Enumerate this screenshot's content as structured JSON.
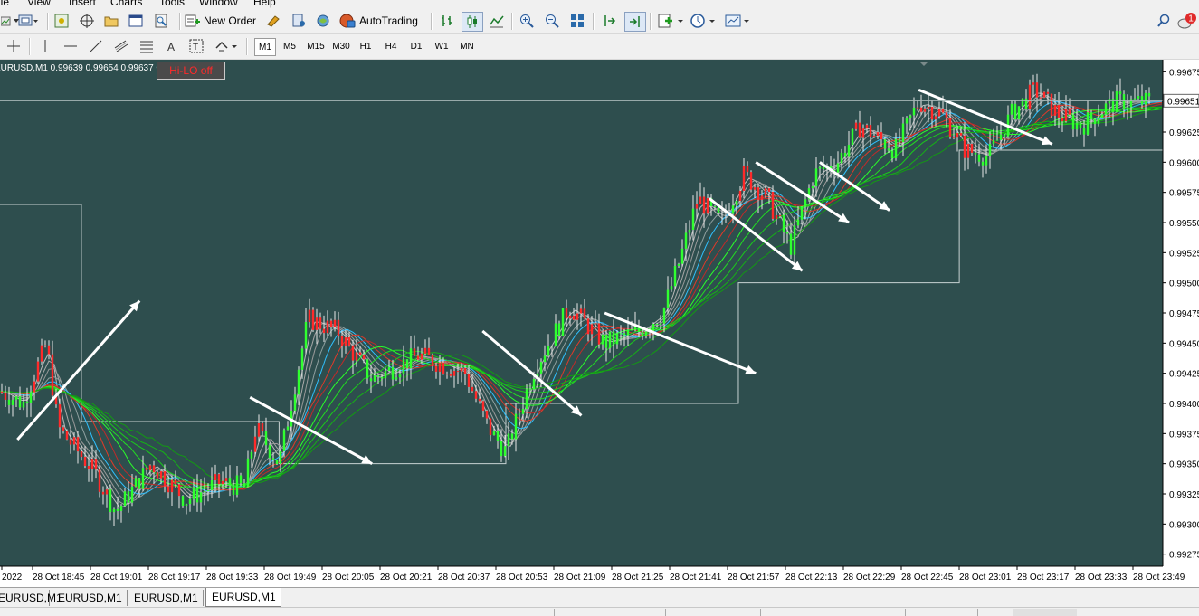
{
  "menu": [
    {
      "label": "ile"
    },
    {
      "label": "View"
    },
    {
      "label": "Insert"
    },
    {
      "label": "Charts"
    },
    {
      "label": "Tools"
    },
    {
      "label": "Window"
    },
    {
      "label": "Help"
    }
  ],
  "toolbar": {
    "new_order": "New Order",
    "auto_trading": "AutoTrading",
    "notification_count": "1"
  },
  "timeframes": [
    "M1",
    "M5",
    "M15",
    "M30",
    "H1",
    "H4",
    "D1",
    "W1",
    "MN"
  ],
  "active_timeframe": "M1",
  "chart_info": {
    "symbol_text": "EURUSD,M1  0.99639 0.99654 0.99637 0.99",
    "indicator_button": "Hi-LO off",
    "indicator_color": "#ff2a2a",
    "background_color": "#2e4e4e",
    "current_price": "0.99651"
  },
  "chart_data": {
    "type": "candlestick",
    "symbol": "EURUSD",
    "timeframe": "M1",
    "price_axis": [
      "0.99675",
      "0.99650",
      "0.99625",
      "0.99600",
      "0.99575",
      "0.99550",
      "0.99525",
      "0.99500",
      "0.99475",
      "0.99450",
      "0.99425",
      "0.99400",
      "0.99375",
      "0.99350",
      "0.99325",
      "0.99300",
      "0.99275"
    ],
    "time_axis": [
      "2022",
      "28 Oct 18:45",
      "28 Oct 19:01",
      "28 Oct 19:17",
      "28 Oct 19:33",
      "28 Oct 19:49",
      "28 Oct 20:05",
      "28 Oct 20:21",
      "28 Oct 20:37",
      "28 Oct 20:53",
      "28 Oct 21:09",
      "28 Oct 21:25",
      "28 Oct 21:41",
      "28 Oct 21:57",
      "28 Oct 22:13",
      "28 Oct 22:29",
      "28 Oct 22:45",
      "28 Oct 23:01",
      "28 Oct 23:17",
      "28 Oct 23:33",
      "28 Oct 23:49"
    ],
    "ylim": [
      0.99265,
      0.99685
    ],
    "current_price": 0.99651,
    "price_path": [
      [
        0,
        0.9941
      ],
      [
        0.02,
        0.994
      ],
      [
        0.04,
        0.9945
      ],
      [
        0.05,
        0.9938
      ],
      [
        0.08,
        0.99345
      ],
      [
        0.1,
        0.9931
      ],
      [
        0.13,
        0.9935
      ],
      [
        0.16,
        0.9932
      ],
      [
        0.19,
        0.99335
      ],
      [
        0.21,
        0.9933
      ],
      [
        0.22,
        0.9938
      ],
      [
        0.24,
        0.9935
      ],
      [
        0.265,
        0.9947
      ],
      [
        0.29,
        0.9946
      ],
      [
        0.32,
        0.9942
      ],
      [
        0.36,
        0.9944
      ],
      [
        0.4,
        0.99425
      ],
      [
        0.42,
        0.9938
      ],
      [
        0.435,
        0.9936
      ],
      [
        0.46,
        0.9943
      ],
      [
        0.49,
        0.9948
      ],
      [
        0.52,
        0.9945
      ],
      [
        0.55,
        0.9946
      ],
      [
        0.57,
        0.99475
      ],
      [
        0.585,
        0.9952
      ],
      [
        0.6,
        0.9957
      ],
      [
        0.62,
        0.9955
      ],
      [
        0.64,
        0.9959
      ],
      [
        0.66,
        0.9957
      ],
      [
        0.68,
        0.9953
      ],
      [
        0.7,
        0.9959
      ],
      [
        0.72,
        0.996
      ],
      [
        0.74,
        0.9963
      ],
      [
        0.77,
        0.9961
      ],
      [
        0.79,
        0.9965
      ],
      [
        0.81,
        0.9964
      ],
      [
        0.83,
        0.9961
      ],
      [
        0.85,
        0.99605
      ],
      [
        0.87,
        0.9964
      ],
      [
        0.89,
        0.9966
      ],
      [
        0.91,
        0.9964
      ],
      [
        0.93,
        0.9963
      ],
      [
        0.95,
        0.99645
      ],
      [
        0.96,
        0.9965
      ]
    ],
    "hilo_steps": [
      [
        0,
        0.99565
      ],
      [
        0.07,
        0.99565
      ],
      [
        0.07,
        0.99385
      ],
      [
        0.24,
        0.99385
      ],
      [
        0.24,
        0.9935
      ],
      [
        0.435,
        0.9935
      ],
      [
        0.435,
        0.994
      ],
      [
        0.635,
        0.994
      ],
      [
        0.635,
        0.995
      ],
      [
        0.825,
        0.995
      ],
      [
        0.825,
        0.9961
      ],
      [
        1.0,
        0.9961
      ]
    ],
    "arrows": [
      [
        [
          0.015,
          0.9937
        ],
        [
          0.12,
          0.99485
        ]
      ],
      [
        [
          0.215,
          0.99405
        ],
        [
          0.32,
          0.9935
        ]
      ],
      [
        [
          0.415,
          0.9946
        ],
        [
          0.5,
          0.9939
        ]
      ],
      [
        [
          0.52,
          0.99475
        ],
        [
          0.65,
          0.99425
        ]
      ],
      [
        [
          0.61,
          0.9957
        ],
        [
          0.69,
          0.9951
        ]
      ],
      [
        [
          0.65,
          0.996
        ],
        [
          0.73,
          0.9955
        ]
      ],
      [
        [
          0.705,
          0.996
        ],
        [
          0.765,
          0.9956
        ]
      ],
      [
        [
          0.79,
          0.9966
        ],
        [
          0.905,
          0.99615
        ]
      ]
    ]
  },
  "tabs": [
    "EURUSD,M1",
    "EURUSD,M1",
    "EURUSD,M1",
    "EURUSD,M1"
  ],
  "active_tab": 3
}
